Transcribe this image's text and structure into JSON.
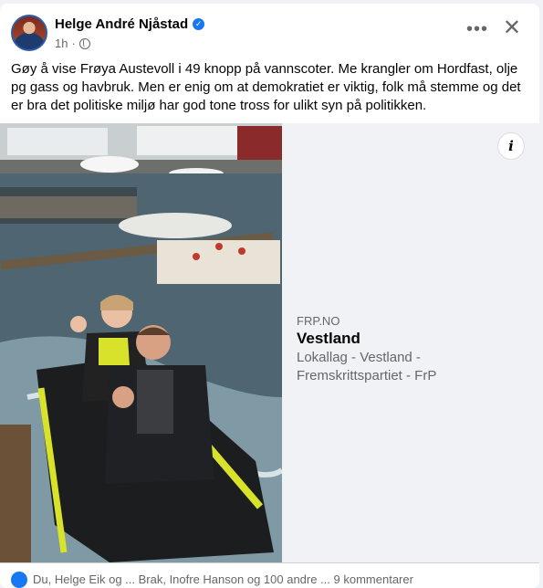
{
  "post": {
    "author": "Helge André Njåstad",
    "time": "1h",
    "text": "Gøy å vise Frøya Austevoll i 49 knopp på vannscoter. Me krangler om Hordfast, olje pg gass og havbruk. Men er enig om at demokratiet er viktig, folk må stemme og det er bra det politiske miljø har god tone tross for ulikt syn på politikken.",
    "more_icon": "ellipsis-icon",
    "close_icon": "close-icon",
    "privacy_icon": "globe-icon"
  },
  "link": {
    "domain": "FRP.NO",
    "title": "Vestland",
    "description": "Lokallag - Vestland - Fremskrittspartiet - FrP",
    "info_label": "i"
  },
  "footer": {
    "text": "Du, Helge Eik og ... Brak, Inofre Hanson og 100 andre ... 9 kommentarer"
  },
  "colors": {
    "accent": "#1877f2",
    "secondary_text": "#65676b",
    "panel": "#f0f2f5"
  }
}
